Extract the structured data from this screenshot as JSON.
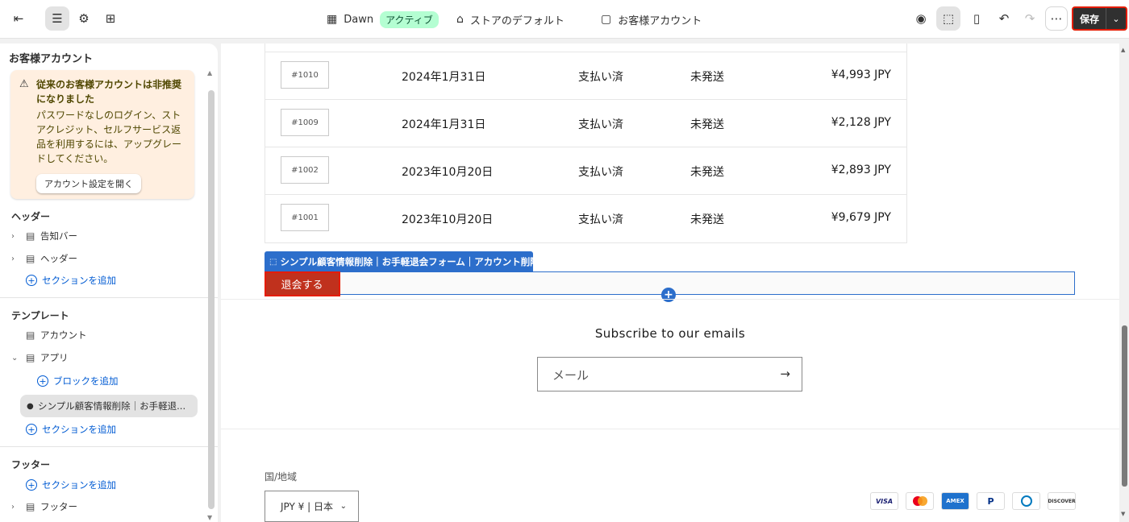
{
  "topbar": {
    "theme_name": "Dawn",
    "theme_status": "アクティブ",
    "store_label": "ストアのデフォルト",
    "page_label": "お客様アカウント",
    "save_label": "保存"
  },
  "sidebar": {
    "title": "お客様アカウント",
    "warning": {
      "title": "従来のお客様アカウントは非推奨になりました",
      "body": "パスワードなしのログイン、ストアクレジット、セルフサービス返品を利用するには、アップグレードしてください。",
      "button": "アカウント設定を開く"
    },
    "header_section": {
      "title": "ヘッダー",
      "items": [
        "告知バー",
        "ヘッダー"
      ],
      "add": "セクションを追加"
    },
    "template_section": {
      "title": "テンプレート",
      "items": [
        "アカウント",
        "アプリ"
      ],
      "add_block": "ブロックを追加",
      "selected": "シンプル顧客情報削除｜お手軽退...",
      "add": "セクションを追加"
    },
    "footer_section": {
      "title": "フッター",
      "add": "セクションを追加",
      "items": [
        "フッター"
      ]
    }
  },
  "preview": {
    "orders": [
      {
        "id": "#1010",
        "date": "2024年1月31日",
        "payment": "支払い済",
        "fulfillment": "未発送",
        "total": "¥4,993 JPY"
      },
      {
        "id": "#1009",
        "date": "2024年1月31日",
        "payment": "支払い済",
        "fulfillment": "未発送",
        "total": "¥2,128 JPY"
      },
      {
        "id": "#1002",
        "date": "2023年10月20日",
        "payment": "支払い済",
        "fulfillment": "未発送",
        "total": "¥2,893 JPY"
      },
      {
        "id": "#1001",
        "date": "2023年10月20日",
        "payment": "支払い済",
        "fulfillment": "未発送",
        "total": "¥9,679 JPY"
      }
    ],
    "app_block_label": "シンプル顧客情報削除｜お手軽退会フォーム｜アカウント削除",
    "quit_button": "退会する",
    "subscribe_title": "Subscribe to our emails",
    "email_placeholder": "メール",
    "country_label": "国/地域",
    "country_value": "JPY ¥ | 日本",
    "payment_icons": [
      "VISA",
      "MC",
      "AMEX",
      "PayPal",
      "Diners",
      "DISCOVER"
    ]
  },
  "colors": {
    "accent": "#2c6ecb",
    "quit_button": "#c0311d",
    "warning_bg": "#ffefe0",
    "badge_bg": "#b4fed2"
  }
}
